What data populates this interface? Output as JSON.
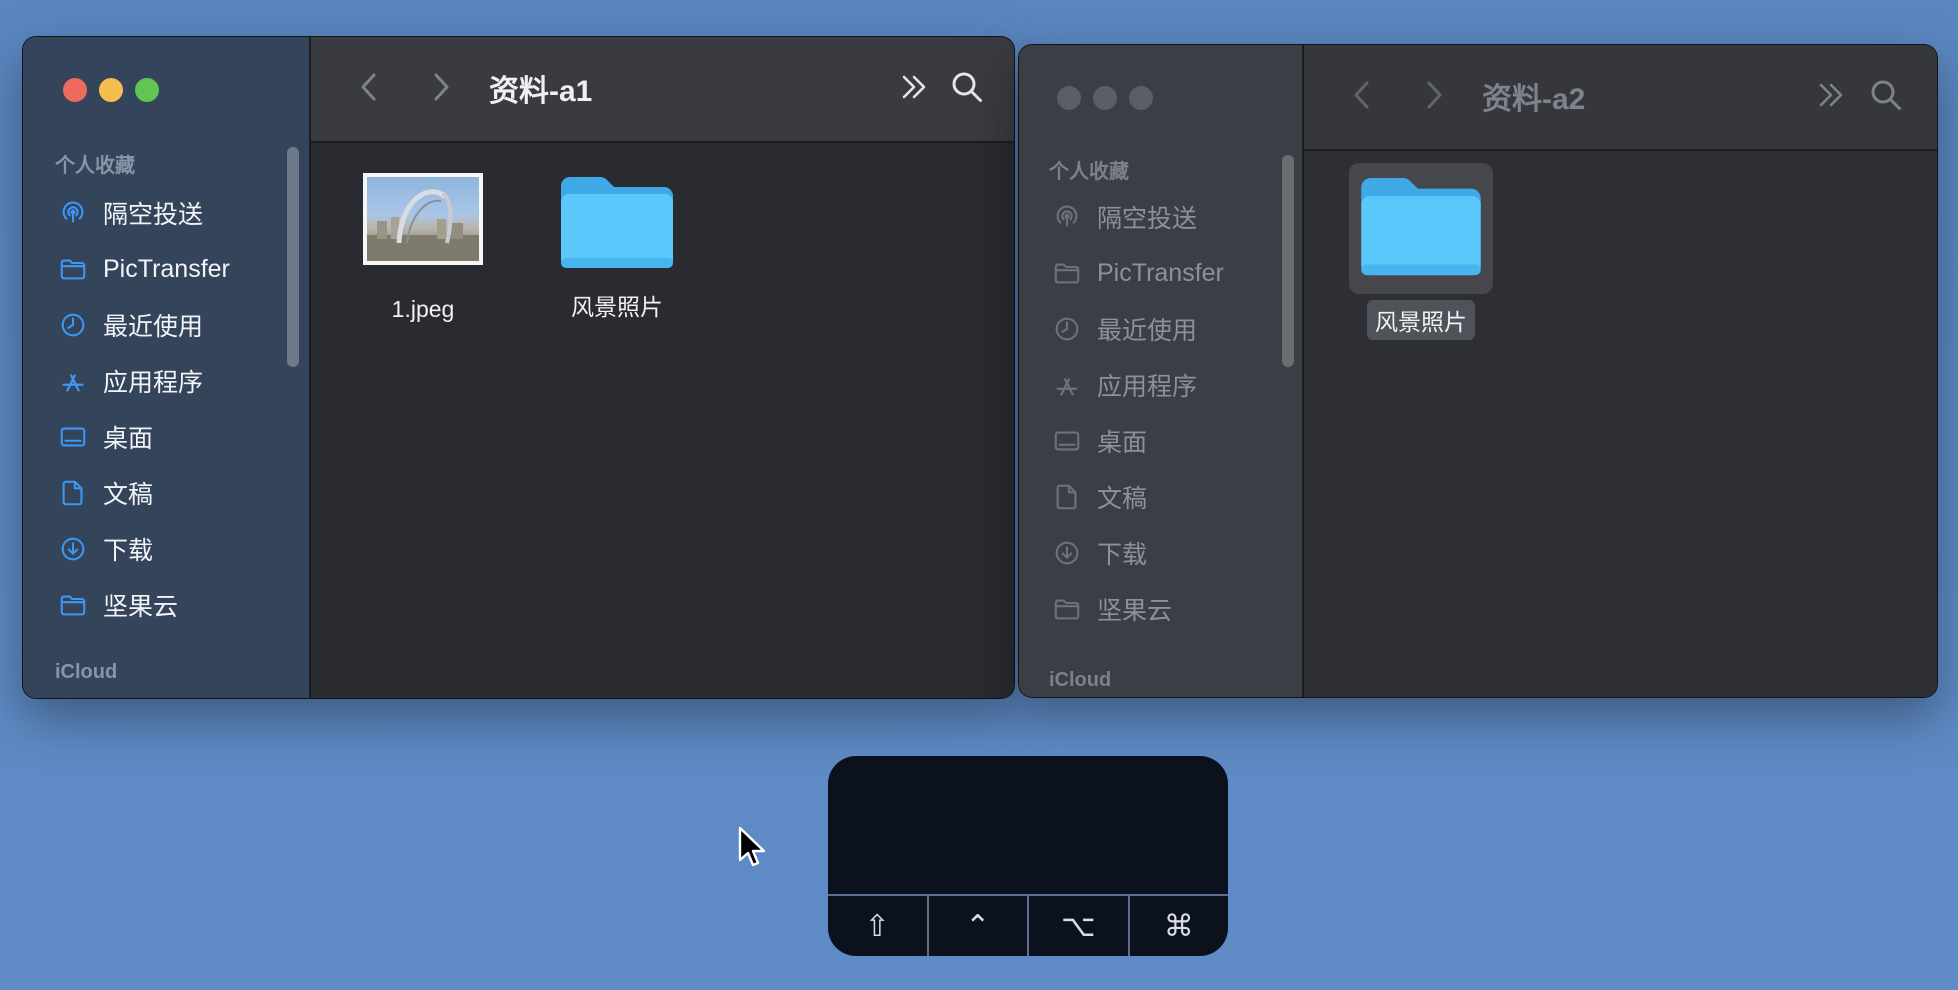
{
  "window1": {
    "title": "资料-a1",
    "sidebar": {
      "favorites_label": "个人收藏",
      "items": [
        {
          "label": "隔空投送",
          "icon": "airdrop-icon"
        },
        {
          "label": "PicTransfer",
          "icon": "folder-icon"
        },
        {
          "label": "最近使用",
          "icon": "clock-icon"
        },
        {
          "label": "应用程序",
          "icon": "apps-icon"
        },
        {
          "label": "桌面",
          "icon": "desktop-icon"
        },
        {
          "label": "文稿",
          "icon": "document-icon"
        },
        {
          "label": "下载",
          "icon": "download-icon"
        },
        {
          "label": "坚果云",
          "icon": "folder-icon"
        }
      ],
      "icloud_label": "iCloud"
    },
    "files": [
      {
        "name": "1.jpeg",
        "kind": "image"
      },
      {
        "name": "风景照片",
        "kind": "folder"
      }
    ]
  },
  "window2": {
    "title": "资料-a2",
    "sidebar": {
      "favorites_label": "个人收藏",
      "items": [
        {
          "label": "隔空投送",
          "icon": "airdrop-icon"
        },
        {
          "label": "PicTransfer",
          "icon": "folder-icon"
        },
        {
          "label": "最近使用",
          "icon": "clock-icon"
        },
        {
          "label": "应用程序",
          "icon": "apps-icon"
        },
        {
          "label": "桌面",
          "icon": "desktop-icon"
        },
        {
          "label": "文稿",
          "icon": "document-icon"
        },
        {
          "label": "下载",
          "icon": "download-icon"
        },
        {
          "label": "坚果云",
          "icon": "folder-icon"
        }
      ],
      "icloud_label": "iCloud"
    },
    "files": [
      {
        "name": "风景照片",
        "kind": "folder",
        "selected": true
      }
    ]
  },
  "keypad": {
    "keys": [
      "⇧",
      "⌃",
      "⌥",
      "⌘"
    ]
  },
  "colors": {
    "accent": "#3d97f5",
    "folder": "#5ac8fa",
    "close": "#ed6a5e",
    "minimize": "#f5bf4f",
    "zoom": "#61c554"
  }
}
